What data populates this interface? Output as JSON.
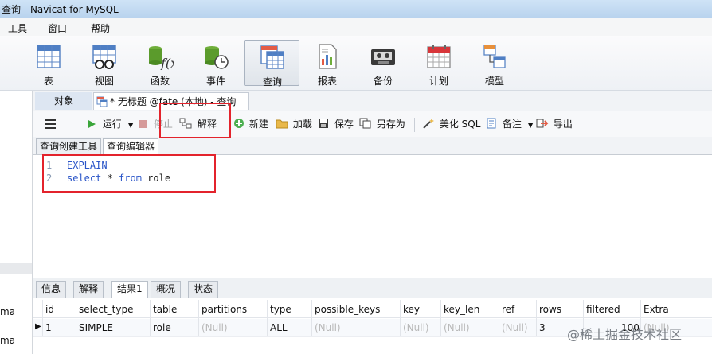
{
  "window": {
    "title": "查询 - Navicat for MySQL"
  },
  "menu": {
    "items": [
      "工具",
      "窗口",
      "帮助"
    ]
  },
  "toolbar": {
    "items": [
      {
        "label": "表",
        "icon": "table-icon"
      },
      {
        "label": "视图",
        "icon": "view-icon"
      },
      {
        "label": "函数",
        "icon": "function-icon"
      },
      {
        "label": "事件",
        "icon": "event-icon"
      },
      {
        "label": "查询",
        "icon": "query-icon"
      },
      {
        "label": "报表",
        "icon": "report-icon"
      },
      {
        "label": "备份",
        "icon": "backup-icon"
      },
      {
        "label": "计划",
        "icon": "schedule-icon"
      },
      {
        "label": "模型",
        "icon": "model-icon"
      }
    ],
    "active": "查询"
  },
  "tabs": {
    "objects": "对象",
    "query": "* 无标题 @fate (本地) - 查询"
  },
  "query_toolbar": {
    "run": "运行",
    "stop": "停止",
    "explain": "解释",
    "new": "新建",
    "load": "加载",
    "save": "保存",
    "save_as": "另存为",
    "beautify": "美化 SQL",
    "comment": "备注",
    "export": "导出"
  },
  "subtabs": {
    "builder": "查询创建工具",
    "editor": "查询编辑器"
  },
  "editor": {
    "lines": [
      {
        "n": "1",
        "text": "EXPLAIN"
      },
      {
        "n": "2",
        "kw1": "select",
        "op": " * ",
        "kw2": "from",
        "rest": " role"
      }
    ]
  },
  "result_tabs": [
    "信息",
    "解释",
    "结果1",
    "概况",
    "状态"
  ],
  "active_result_tab": "结果1",
  "grid": {
    "columns": [
      "id",
      "select_type",
      "table",
      "partitions",
      "type",
      "possible_keys",
      "key",
      "key_len",
      "ref",
      "rows",
      "filtered",
      "Extra"
    ],
    "row": [
      "1",
      "SIMPLE",
      "role",
      "(Null)",
      "ALL",
      "(Null)",
      "(Null)",
      "(Null)",
      "(Null)",
      "3",
      "100",
      "(Null)"
    ]
  },
  "left_panel": {
    "labels": [
      "ma",
      "ma"
    ]
  },
  "watermark": "@稀土掘金技术社区"
}
